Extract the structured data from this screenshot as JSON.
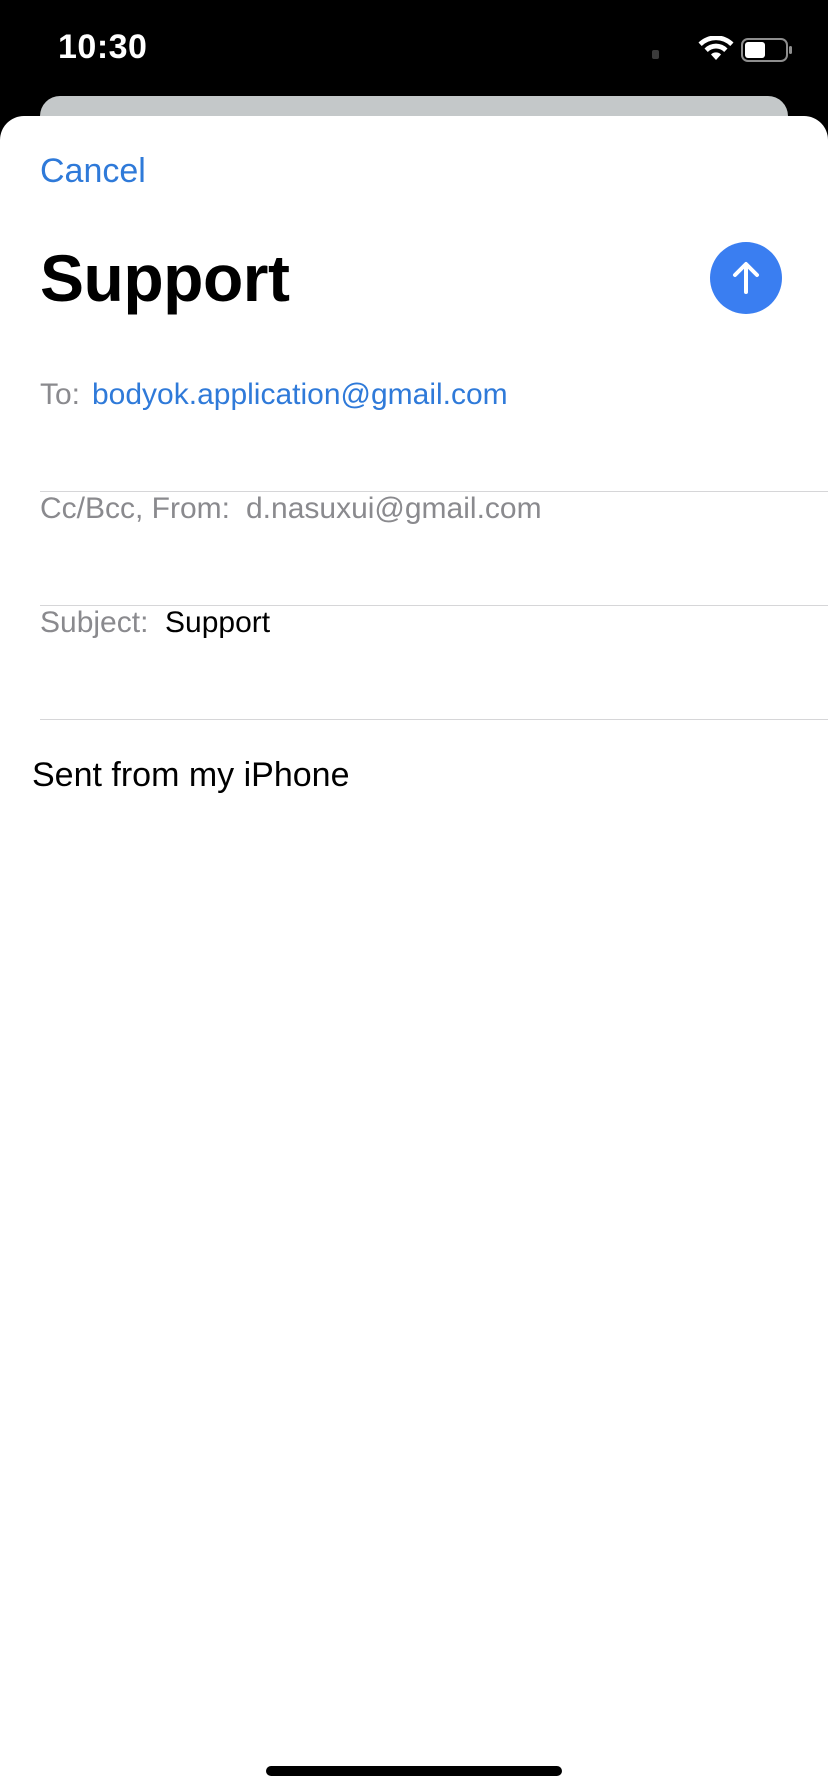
{
  "status_bar": {
    "time": "10:30",
    "icons": [
      "wifi-icon",
      "battery-icon"
    ]
  },
  "compose": {
    "cancel_label": "Cancel",
    "title": "Support",
    "send_icon": "arrow-up-icon",
    "to": {
      "label": "To:",
      "value": "bodyok.application@gmail.com"
    },
    "cc_from": {
      "label": "Cc/Bcc, From:",
      "value": "d.nasuxui@gmail.com"
    },
    "subject": {
      "label": "Subject:",
      "value": "Support"
    },
    "body": "Sent from my iPhone"
  },
  "colors": {
    "accent": "#2f7ad9",
    "send_button": "#3a7ef1",
    "secondary_text": "#8a8a8e",
    "separator": "#d6d6d8",
    "backdrop_card": "#c4c8c9"
  }
}
